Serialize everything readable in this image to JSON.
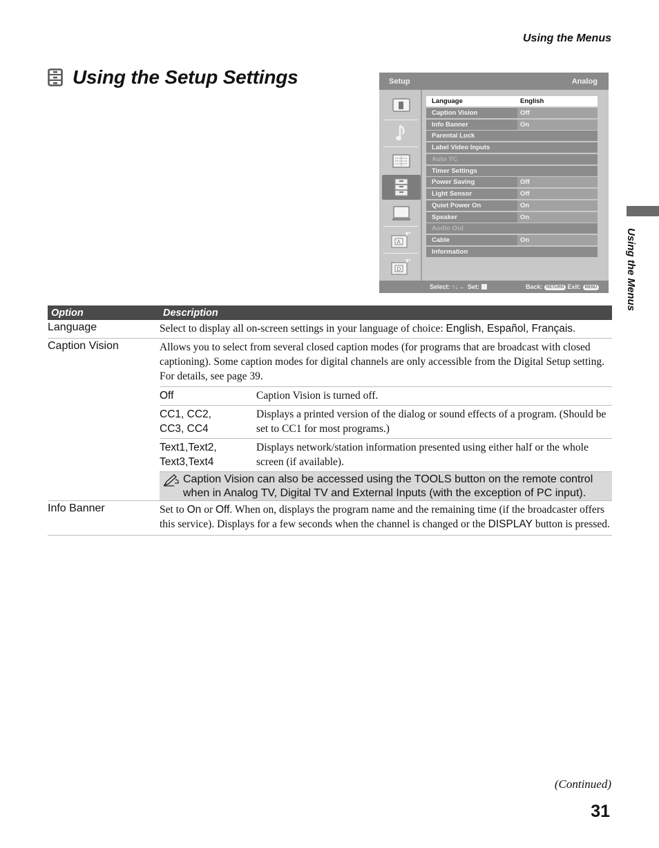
{
  "running_head": "Using the Menus",
  "side_tab_label": "Using the Menus",
  "title": "Using the Setup Settings",
  "title_icon": "setup-drawer-icon",
  "tv_menu": {
    "header_left": "Setup",
    "header_right": "Analog",
    "side_icons": [
      "picture-icon",
      "sound-icon",
      "screen-icon",
      "setup-icon",
      "pc-icon",
      "analog-setup-icon",
      "digital-setup-icon"
    ],
    "active_side_icon": "setup-icon",
    "items": [
      {
        "label": "Language",
        "value": "English",
        "state": "selected"
      },
      {
        "label": "Caption Vision",
        "value": "Off",
        "state": "normal"
      },
      {
        "label": "Info Banner",
        "value": "On",
        "state": "normal"
      },
      {
        "label": "Parental Lock",
        "value": "",
        "state": "normal"
      },
      {
        "label": "Label Video Inputs",
        "value": "",
        "state": "normal"
      },
      {
        "label": "Auto YC",
        "value": "",
        "state": "disabled"
      },
      {
        "label": "Timer Settings",
        "value": "",
        "state": "normal"
      },
      {
        "label": "Power Saving",
        "value": "Off",
        "state": "normal"
      },
      {
        "label": "Light Sensor",
        "value": "Off",
        "state": "normal"
      },
      {
        "label": "Quiet Power On",
        "value": "On",
        "state": "normal"
      },
      {
        "label": "Speaker",
        "value": "On",
        "state": "normal"
      },
      {
        "label": "Audio Out",
        "value": "",
        "state": "disabled"
      },
      {
        "label": "Cable",
        "value": "On",
        "state": "normal"
      },
      {
        "label": "Information",
        "value": "",
        "state": "normal"
      }
    ],
    "footer": {
      "select_label": "Select:",
      "select_arrows": "↑↓→",
      "set_label": "Set:",
      "back_label": "Back:",
      "back_button": "RETURN",
      "exit_label": "Exit:",
      "exit_button": "MENU"
    }
  },
  "table": {
    "headers": {
      "option": "Option",
      "description": "Description"
    },
    "language": {
      "option": "Language",
      "desc_text": "Select to display all on-screen settings in your language of choice: ",
      "desc_choices": "English, Español, Français."
    },
    "caption_vision": {
      "option": "Caption Vision",
      "desc_a": "Allows you to select from several closed caption modes (for programs that are broadcast with closed captioning). Some caption modes for digital channels are only accessible from the ",
      "desc_link": "Digital Setup",
      "desc_b": " setting. For details, see page 39.",
      "modes": [
        {
          "key": "Off",
          "desc_name": "Caption Vision",
          "desc": " is turned off."
        },
        {
          "key": "CC1, CC2,\nCC3, CC4",
          "desc_a": "Displays a printed version of the dialog or sound effects of a program. (Should be set to ",
          "desc_em": "CC1",
          "desc_b": " for most programs.)"
        },
        {
          "key": "Text1,Text2,\nText3,Text4",
          "desc": "Displays network/station information presented using either half or the whole screen (if available)."
        }
      ],
      "note": "Caption Vision can also be accessed using the TOOLS button on the remote control when in Analog TV, Digital TV and External Inputs (with the exception of PC input)."
    },
    "info_banner": {
      "option": "Info Banner",
      "desc_a": "Set to ",
      "on": "On",
      "desc_or": " or ",
      "off": "Off",
      "desc_b": ". When on, displays the program name and the remaining time (if the broadcaster offers this service). Displays for a few seconds when the channel is changed or the ",
      "display": "DISPLAY",
      "desc_c": " button is pressed."
    }
  },
  "continued": "(Continued)",
  "page_number": "31"
}
